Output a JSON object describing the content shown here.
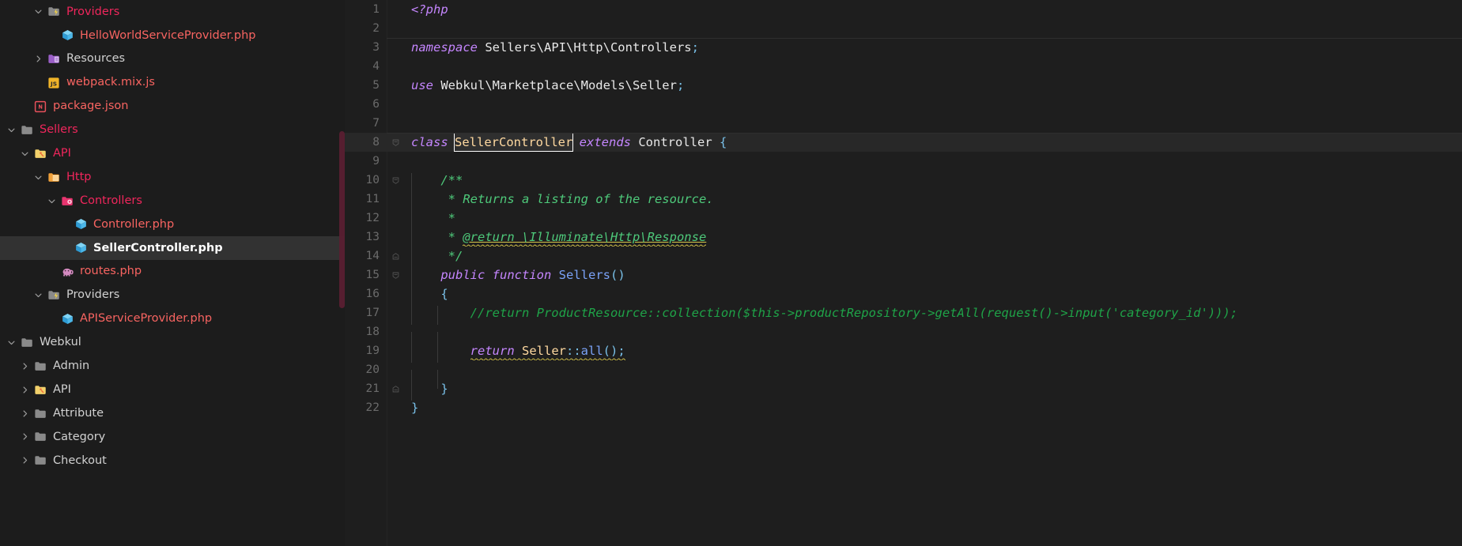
{
  "sidebar": {
    "scrollbar": {
      "color": "#5a1f32"
    },
    "items": [
      {
        "label": "Providers",
        "depth": 3,
        "twisty": "chevron-down-icon",
        "icon": "folder-providers-open-icon",
        "color": "#f0265c",
        "selected": false
      },
      {
        "label": "HelloWorldServiceProvider.php",
        "depth": 4,
        "twisty": "none",
        "icon": "php-class-icon",
        "color": "#f86461",
        "selected": false
      },
      {
        "label": "Resources",
        "depth": 3,
        "twisty": "chevron-right-icon",
        "icon": "folder-resource-icon",
        "color": "#d1d1d1",
        "selected": false
      },
      {
        "label": "webpack.mix.js",
        "depth": 3,
        "twisty": "none",
        "icon": "javascript-icon",
        "color": "#f86461",
        "selected": false
      },
      {
        "label": "package.json",
        "depth": 2,
        "twisty": "none",
        "icon": "nodejs-package-icon",
        "color": "#f86461",
        "selected": false
      },
      {
        "label": "Sellers",
        "depth": 1,
        "twisty": "chevron-down-icon",
        "icon": "folder-open-icon",
        "color": "#f0265c",
        "selected": false
      },
      {
        "label": "API",
        "depth": 2,
        "twisty": "chevron-down-icon",
        "icon": "folder-api-open-icon",
        "color": "#f0265c",
        "selected": false
      },
      {
        "label": "Http",
        "depth": 3,
        "twisty": "chevron-down-icon",
        "icon": "folder-http-open-icon",
        "color": "#f0265c",
        "selected": false
      },
      {
        "label": "Controllers",
        "depth": 4,
        "twisty": "chevron-down-icon",
        "icon": "folder-controller-open-icon",
        "color": "#f0265c",
        "selected": false
      },
      {
        "label": "Controller.php",
        "depth": 5,
        "twisty": "none",
        "icon": "php-class-icon",
        "color": "#f86461",
        "selected": false
      },
      {
        "label": "SellerController.php",
        "depth": 5,
        "twisty": "none",
        "icon": "php-class-icon",
        "color": "#ffffff",
        "selected": true
      },
      {
        "label": "routes.php",
        "depth": 4,
        "twisty": "none",
        "icon": "php-elephant-icon",
        "color": "#f86461",
        "selected": false
      },
      {
        "label": "Providers",
        "depth": 3,
        "twisty": "chevron-down-icon",
        "icon": "folder-providers-open-icon",
        "color": "#d1d1d1",
        "selected": false
      },
      {
        "label": "APIServiceProvider.php",
        "depth": 4,
        "twisty": "none",
        "icon": "php-class-icon",
        "color": "#f86461",
        "selected": false
      },
      {
        "label": "Webkul",
        "depth": 1,
        "twisty": "chevron-down-icon",
        "icon": "folder-open-icon",
        "color": "#d1d1d1",
        "selected": false
      },
      {
        "label": "Admin",
        "depth": 2,
        "twisty": "chevron-right-icon",
        "icon": "folder-icon",
        "color": "#d1d1d1",
        "selected": false
      },
      {
        "label": "API",
        "depth": 2,
        "twisty": "chevron-right-icon",
        "icon": "folder-api-icon",
        "color": "#d1d1d1",
        "selected": false
      },
      {
        "label": "Attribute",
        "depth": 2,
        "twisty": "chevron-right-icon",
        "icon": "folder-icon",
        "color": "#d1d1d1",
        "selected": false
      },
      {
        "label": "Category",
        "depth": 2,
        "twisty": "chevron-right-icon",
        "icon": "folder-icon",
        "color": "#d1d1d1",
        "selected": false
      },
      {
        "label": "Checkout",
        "depth": 2,
        "twisty": "chevron-right-icon",
        "icon": "folder-icon",
        "color": "#d1d1d1",
        "selected": false
      }
    ]
  },
  "editor": {
    "language": "php",
    "current_line": 8,
    "occurrence_token": "SellerController",
    "lines": [
      {
        "n": "1",
        "fold": "none"
      },
      {
        "n": "2",
        "fold": "none"
      },
      {
        "n": "3",
        "fold": "none"
      },
      {
        "n": "4",
        "fold": "none"
      },
      {
        "n": "5",
        "fold": "none"
      },
      {
        "n": "6",
        "fold": "none"
      },
      {
        "n": "7",
        "fold": "none"
      },
      {
        "n": "8",
        "fold": "collapse"
      },
      {
        "n": "9",
        "fold": "none"
      },
      {
        "n": "10",
        "fold": "collapse"
      },
      {
        "n": "11",
        "fold": "none"
      },
      {
        "n": "12",
        "fold": "none"
      },
      {
        "n": "13",
        "fold": "none"
      },
      {
        "n": "14",
        "fold": "end"
      },
      {
        "n": "15",
        "fold": "collapse"
      },
      {
        "n": "16",
        "fold": "none"
      },
      {
        "n": "17",
        "fold": "none"
      },
      {
        "n": "18",
        "fold": "none"
      },
      {
        "n": "19",
        "fold": "none"
      },
      {
        "n": "20",
        "fold": "none"
      },
      {
        "n": "21",
        "fold": "end"
      },
      {
        "n": "22",
        "fold": "none"
      }
    ],
    "source_text": [
      "<?php",
      "",
      "namespace Sellers\\API\\Http\\Controllers;",
      "",
      "use Webkul\\Marketplace\\Models\\Seller;",
      "",
      "",
      "class SellerController extends Controller {",
      "",
      "    /**",
      "     * Returns a listing of the resource.",
      "     *",
      "     * @return \\Illuminate\\Http\\Response",
      "     */",
      "    public function Sellers()",
      "    {",
      "        //return ProductResource::collection($this->productRepository->getAll(request()->input('category_id')));",
      "",
      "        return Seller::all();",
      "",
      "    }",
      "}"
    ],
    "warnings": [
      {
        "line": 13,
        "text": "@return \\Illuminate\\Http\\Response"
      },
      {
        "line": 19,
        "text": "return Seller::all();"
      }
    ]
  }
}
